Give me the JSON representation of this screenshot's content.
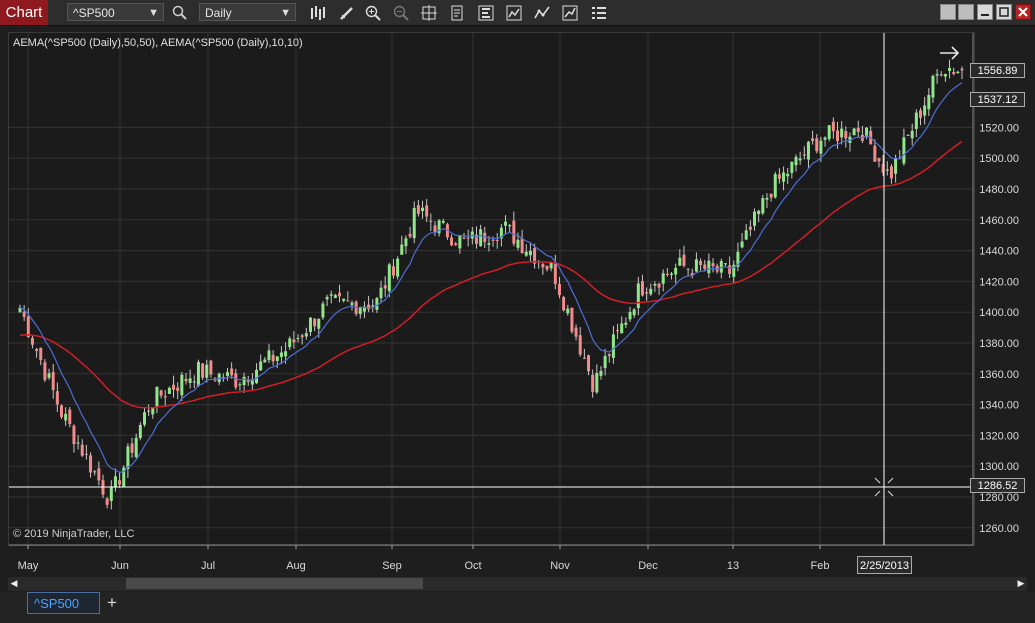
{
  "app": {
    "tab_label": "Chart"
  },
  "toolbar": {
    "instrument": "^SP500",
    "interval": "Daily",
    "icons": [
      "search-icon",
      "bar-type-icon",
      "drawing-tools-icon",
      "zoom-in-icon",
      "zoom-out-icon",
      "crosshair-icon",
      "properties-icon",
      "indicators-icon",
      "strategies-icon",
      "chart-trader-icon",
      "templates-icon",
      "data-box-icon"
    ]
  },
  "chart": {
    "indicator_label": "AEMA(^SP500 (Daily),50,50), AEMA(^SP500 (Daily),10,10)",
    "copyright": "© 2019 NinjaTrader, LLC",
    "last_price": "1556.89",
    "ema50_value": "1537.12",
    "crosshair_price": "1286.52",
    "crosshair_date": "2/25/2013",
    "price_ticks": [
      "1520.00",
      "1500.00",
      "1480.00",
      "1460.00",
      "1440.00",
      "1420.00",
      "1400.00",
      "1380.00",
      "1360.00",
      "1340.00",
      "1320.00",
      "1300.00",
      "1280.00",
      "1260.00"
    ],
    "month_labels": [
      "May",
      "Jun",
      "Jul",
      "Aug",
      "Sep",
      "Oct",
      "Nov",
      "Dec",
      "13",
      "Feb"
    ]
  },
  "colors": {
    "up": "#90e68a",
    "down": "#f28b8b",
    "ema_fast": "#4c6fd6",
    "ema_slow": "#d11f26",
    "grid": "#333333"
  },
  "chart_data": {
    "type": "candlestick",
    "instrument": "^SP500",
    "interval": "Daily",
    "approx_close_path": [
      {
        "date": "2012-05-01",
        "close": 1403
      },
      {
        "date": "2012-05-15",
        "close": 1336
      },
      {
        "date": "2012-06-01",
        "close": 1278
      },
      {
        "date": "2012-06-15",
        "close": 1342
      },
      {
        "date": "2012-07-01",
        "close": 1362
      },
      {
        "date": "2012-07-15",
        "close": 1356
      },
      {
        "date": "2012-08-01",
        "close": 1376
      },
      {
        "date": "2012-08-15",
        "close": 1405
      },
      {
        "date": "2012-09-01",
        "close": 1406
      },
      {
        "date": "2012-09-15",
        "close": 1465
      },
      {
        "date": "2012-10-01",
        "close": 1445
      },
      {
        "date": "2012-10-15",
        "close": 1455
      },
      {
        "date": "2012-11-01",
        "close": 1427
      },
      {
        "date": "2012-11-15",
        "close": 1353
      },
      {
        "date": "2012-12-01",
        "close": 1416
      },
      {
        "date": "2012-12-15",
        "close": 1430
      },
      {
        "date": "2013-01-01",
        "close": 1426
      },
      {
        "date": "2013-01-15",
        "close": 1480
      },
      {
        "date": "2013-02-01",
        "close": 1513
      },
      {
        "date": "2013-02-15",
        "close": 1520
      },
      {
        "date": "2013-02-25",
        "close": 1488
      },
      {
        "date": "2013-03-15",
        "close": 1560
      },
      {
        "date": "2013-03-22",
        "close": 1556.89
      }
    ],
    "series": [
      {
        "name": "AEMA(^SP500 (Daily),50,50)"
      },
      {
        "name": "AEMA(^SP500 (Daily),10,10)"
      }
    ],
    "ylim": [
      1250,
      1570
    ]
  }
}
